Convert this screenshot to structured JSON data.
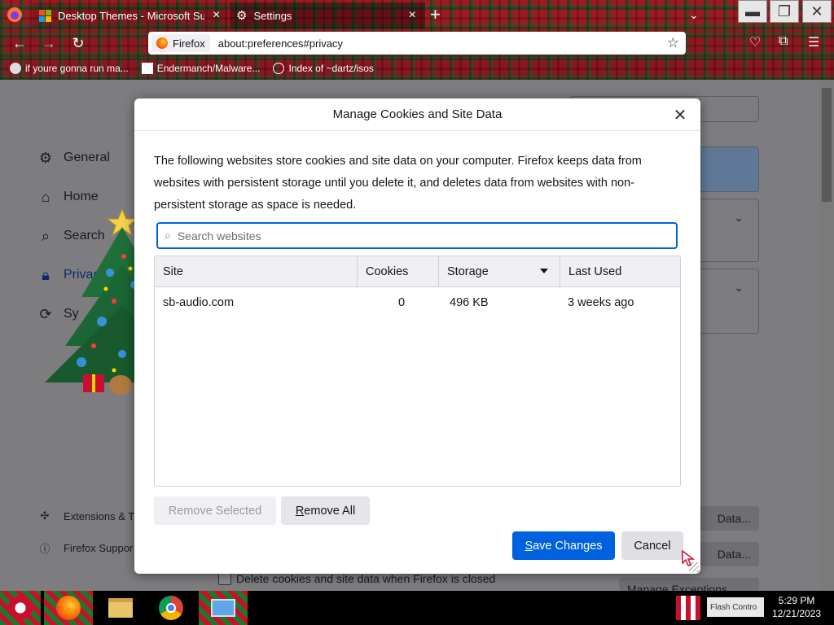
{
  "tabs": [
    {
      "label": "Desktop Themes - Microsoft Supp",
      "active": false
    },
    {
      "label": "Settings",
      "active": true
    }
  ],
  "navbar": {
    "identity_label": "Firefox",
    "url": "about:preferences#privacy"
  },
  "bookmarks": [
    {
      "label": "if youre gonna run ma..."
    },
    {
      "label": "Endermanch/Malware..."
    },
    {
      "label": "Index of ~dartz/isos"
    }
  ],
  "sidebar": {
    "items": [
      {
        "label": "General",
        "icon": "gear-icon"
      },
      {
        "label": "Home",
        "icon": "home-icon"
      },
      {
        "label": "Search",
        "icon": "search-icon"
      },
      {
        "label": "Privac",
        "icon": "lock-icon"
      },
      {
        "label": "Sy",
        "icon": "sync-icon"
      }
    ],
    "footer": [
      {
        "label": "Extensions & T",
        "icon": "puzzle-icon"
      },
      {
        "label": "Firefox Suppor",
        "icon": "help-icon"
      }
    ]
  },
  "background": {
    "manage_data_btn": "Data...",
    "clear_data_btn": "Data...",
    "manage_exceptions_btn": "Manage Exceptions...",
    "delete_on_close_label": "Delete cookies and site data when Firefox is closed"
  },
  "dialog": {
    "title": "Manage Cookies and Site Data",
    "description": "The following websites store cookies and site data on your computer. Firefox keeps data from websites with persistent storage until you delete it, and deletes data from websites with non-persistent storage as space is needed.",
    "search_placeholder": "Search websites",
    "columns": {
      "site": "Site",
      "cookies": "Cookies",
      "storage": "Storage",
      "last_used": "Last Used"
    },
    "rows": [
      {
        "site": "sb-audio.com",
        "cookies": "0",
        "storage": "496 KB",
        "last_used": "3 weeks ago"
      }
    ],
    "remove_selected": "Remove Selected",
    "remove_all_u": "R",
    "remove_all_rest": "emove All",
    "save_u": "S",
    "save_rest": "ave Changes",
    "cancel": "Cancel"
  },
  "taskbar": {
    "clock_time": "5:29 PM",
    "clock_date": "12/21/2023",
    "tray_label": "Flash Contro"
  },
  "colors": {
    "accent": "#0061e0",
    "tab_bar": "#9c1a22"
  }
}
